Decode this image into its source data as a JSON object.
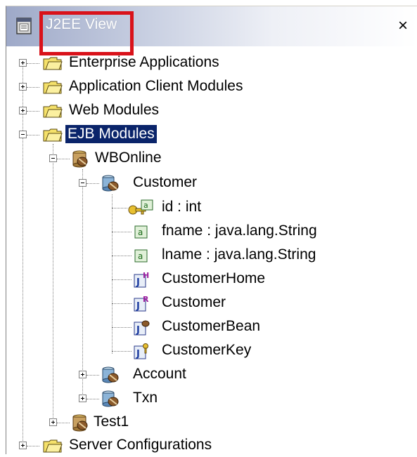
{
  "window": {
    "title": "J2EE View",
    "close_label": "×"
  },
  "tree": {
    "enterprise_applications": "Enterprise Applications",
    "application_client_modules": "Application Client Modules",
    "web_modules": "Web Modules",
    "ejb_modules": "EJB Modules",
    "wbonline": "WBOnline",
    "customer_entity": "Customer",
    "id_field": "id : int",
    "fname_field": "fname : java.lang.String",
    "lname_field": "lname : java.lang.String",
    "customer_home": "CustomerHome",
    "customer_remote": "Customer",
    "customer_bean": "CustomerBean",
    "customer_key": "CustomerKey",
    "account": "Account",
    "txn": "Txn",
    "test1": "Test1",
    "server_configurations": "Server Configurations"
  },
  "colors": {
    "highlight": "#d9121a",
    "selection": "#0a246a",
    "folder": "#f5e16a"
  }
}
